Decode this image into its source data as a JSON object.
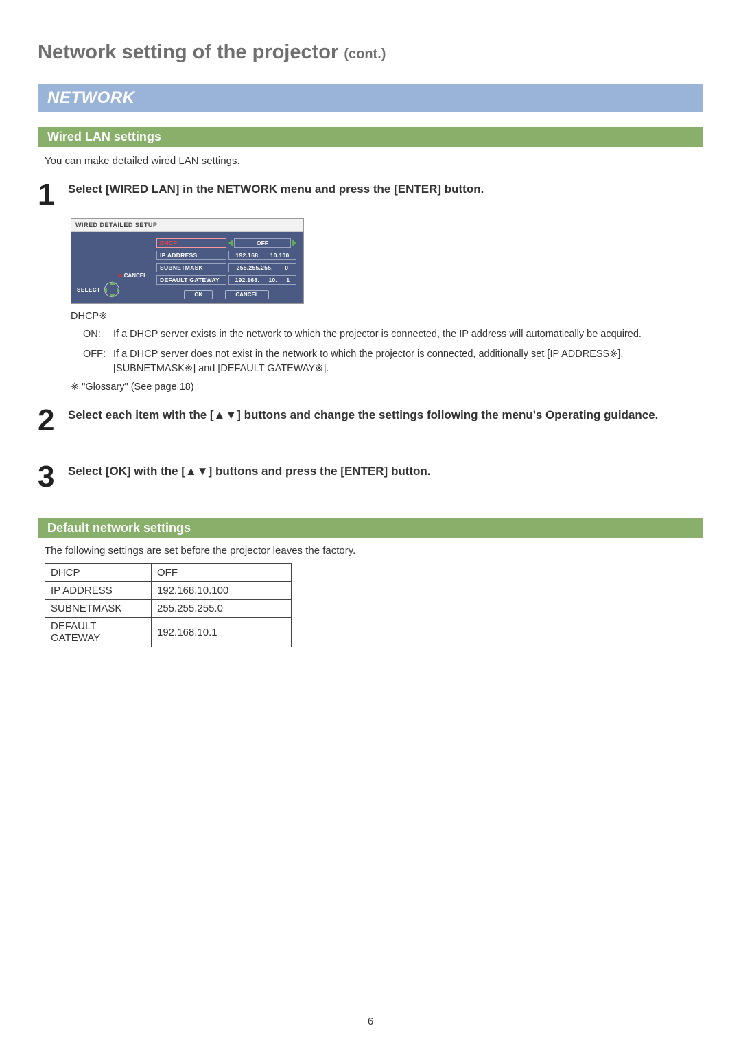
{
  "page_title_main": "Network setting of the projector",
  "page_title_cont": "(cont.)",
  "section_heading": "NETWORK",
  "subsection1": "Wired LAN settings",
  "wired_intro": "You can make detailed wired LAN settings.",
  "steps": {
    "s1": {
      "num": "1",
      "title": "Select [WIRED LAN] in the NETWORK menu and press the [ENTER] button."
    },
    "s2": {
      "num": "2",
      "title": "Select each item with the [▲▼] buttons and change the settings following the menu's Operating guidance."
    },
    "s3": {
      "num": "3",
      "title": "Select [OK] with the [▲▼] buttons and press the [ENTER] button."
    }
  },
  "osd": {
    "title": "WIRED DETAILED SETUP",
    "cancel": "CANCEL",
    "select": "SELECT",
    "rows": {
      "dhcp": {
        "label": "DHCP",
        "value": "OFF"
      },
      "ip": {
        "label": "IP ADDRESS",
        "value_parts": [
          "192.168.",
          "10.100"
        ]
      },
      "sn": {
        "label": "SUBNETMASK",
        "value_parts": [
          "255.255.255.",
          "0"
        ]
      },
      "gw": {
        "label": "DEFAULT GATEWAY",
        "value_parts": [
          "192.168.",
          "10.",
          "1"
        ]
      }
    },
    "ok": "OK",
    "cancel_btn": "CANCEL"
  },
  "dhcp_section": {
    "head_label": "DHCP",
    "head_mark": "※",
    "on_label": "ON:",
    "on_text": "If a DHCP server exists in the network to which the projector is connected, the IP address will automatically be acquired.",
    "off_label": "OFF:",
    "off_text_pre": "If a DHCP server does not exist in the network to which the projector is connected, additionally set [IP ADDRESS",
    "off_text_mid1": "], [SUBNETMASK",
    "off_text_mid2": "] and [DEFAULT GATEWAY",
    "off_text_end": "].",
    "mark": "※"
  },
  "glossary": {
    "mark": "※",
    "text": "\"Glossary\" (See page 18)"
  },
  "subsection2": "Default network settings",
  "defaults_intro": "The following settings are set before the projector leaves the factory.",
  "defaults": {
    "r1": {
      "k": "DHCP",
      "v": "OFF"
    },
    "r2": {
      "k": "IP ADDRESS",
      "v": "192.168.10.100"
    },
    "r3": {
      "k": "SUBNETMASK",
      "v": "255.255.255.0"
    },
    "r4": {
      "k": "DEFAULT GATEWAY",
      "v": "192.168.10.1"
    }
  },
  "page_number": "6"
}
